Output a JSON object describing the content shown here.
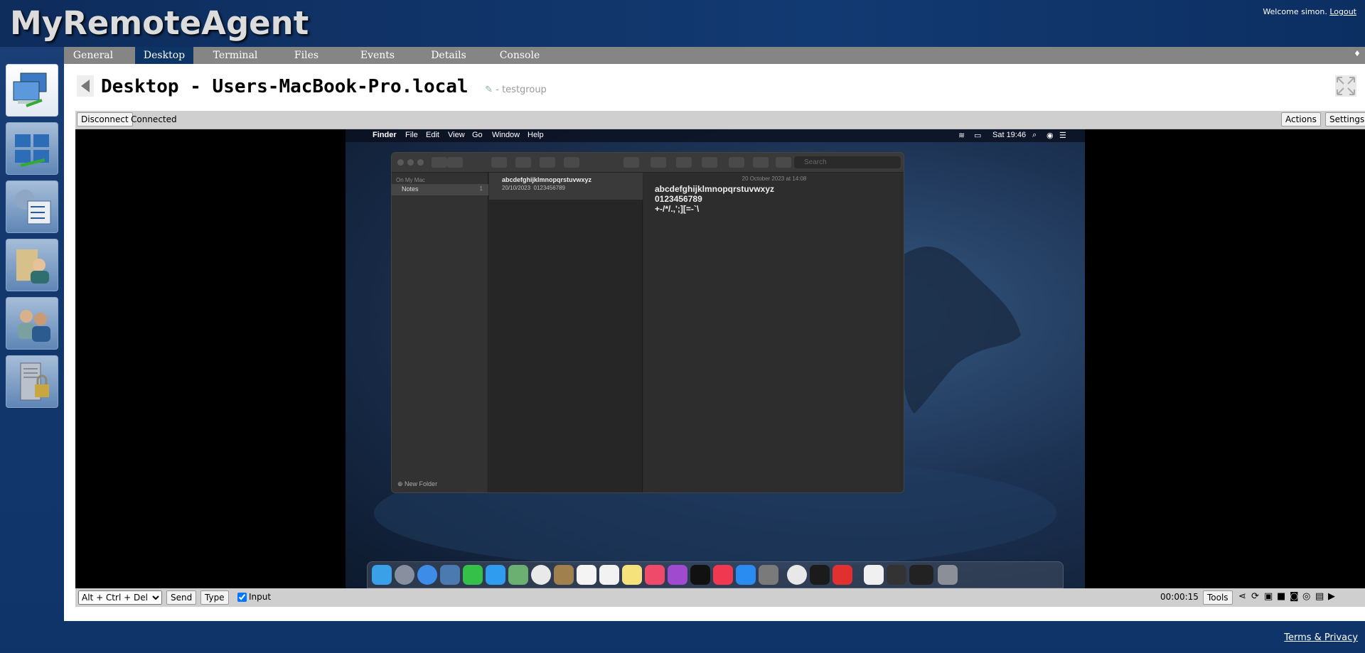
{
  "header": {
    "logo": "MyRemoteAgent",
    "welcome": "Welcome simon.",
    "logout": "Logout"
  },
  "tabs": [
    "General",
    "Desktop",
    "Terminal",
    "Files",
    "Events",
    "Details",
    "Console"
  ],
  "active_tab": "Desktop",
  "sidebar": {
    "items": [
      {
        "name": "my-devices-icon"
      },
      {
        "name": "my-server-icon"
      },
      {
        "name": "my-events-icon"
      },
      {
        "name": "my-files-icon"
      },
      {
        "name": "my-users-icon"
      },
      {
        "name": "server-security-icon"
      }
    ]
  },
  "page": {
    "title": "Desktop - Users-MacBook-Pro.local",
    "group": "- testgroup"
  },
  "toolbar": {
    "disconnect": "Disconnect",
    "status": "Connected",
    "actions": "Actions",
    "settings": "Settings..."
  },
  "remote": {
    "menubar": {
      "app": "Finder",
      "items": [
        "File",
        "Edit",
        "View",
        "Go",
        "Window",
        "Help"
      ],
      "clock": "Sat 19:46"
    },
    "notes": {
      "search_placeholder": "Search",
      "section": "On My Mac",
      "folder": "Notes",
      "folder_count": "1",
      "new_folder": "New Folder",
      "note_title": "abcdefghijklmnopqrstuvwxyz",
      "note_date": "20/10/2023",
      "note_preview": "0123456789",
      "body_date": "20 October 2023 at 14:08",
      "body_lines": [
        "abcdefghijklmnopqrstuvwxyz",
        "0123456789",
        "+-/*/.,';][=-`\\"
      ]
    }
  },
  "bottombar": {
    "key_combo": "Alt + Ctrl + Del",
    "send": "Send",
    "type": "Type",
    "input_label": "Input",
    "input_checked": true,
    "timer": "00:00:15",
    "tools": "Tools"
  },
  "footer": {
    "terms": "Terms & Privacy"
  },
  "colors": {
    "header_bg": "#123a72",
    "tab_bar": "#858585",
    "active_tab": "#0c3566"
  }
}
